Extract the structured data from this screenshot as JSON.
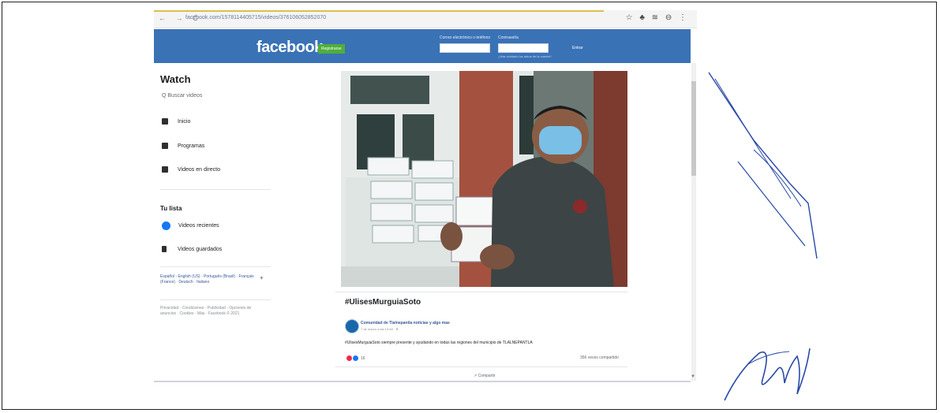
{
  "browser": {
    "url": "facebook.com/1578114405715/videos/376106052852070",
    "nav_icons": "← → C ",
    "extension_icons": "☆ ♣ ≋ ⊖ ⋮"
  },
  "header": {
    "logo": "facebook",
    "register_label": "Registrarse",
    "email_label": "Correo electrónico o teléfono",
    "password_label": "Contraseña",
    "login_label": "Entrar",
    "forgot_label": "¿Has olvidado los datos de la cuenta?"
  },
  "sidebar": {
    "title": "Watch",
    "search_placeholder": "Q Buscar videos",
    "items": [
      {
        "label": "Inicio",
        "icon": "home-icon"
      },
      {
        "label": "Programas",
        "icon": "shows-icon"
      },
      {
        "label": "Videos en directo",
        "icon": "live-icon"
      }
    ],
    "section_title": "Tu lista",
    "list_items": [
      {
        "label": "Videos recientes",
        "icon": "play-icon"
      },
      {
        "label": "Videos guardados",
        "icon": "bookmark-icon"
      }
    ],
    "languages": "Español · English (US) · Português (Brasil) · Français (France) · Deutsch · Italiano",
    "legal": "Privacidad · Condiciones · Publicidad · Opciones de anuncios · Cookies · Más · Facebook © 2021"
  },
  "post": {
    "hashtag": "#UlisesMurguiaSoto",
    "page_name": "Comunidad de Tlalnepantla noticias y algo mas",
    "date": "7 de marzo a las 14:48 · ⚙",
    "text": "#UlisesMurguiaSoto siempre presente y ayudando en todas las regiones del municipio de TLALNEPANTLA",
    "reaction_count": "16",
    "shares": "356 veces compartido",
    "share_label": "Compartir",
    "colors": {
      "like": "#1877f2",
      "love": "#f0284a",
      "link": "#385898"
    }
  }
}
